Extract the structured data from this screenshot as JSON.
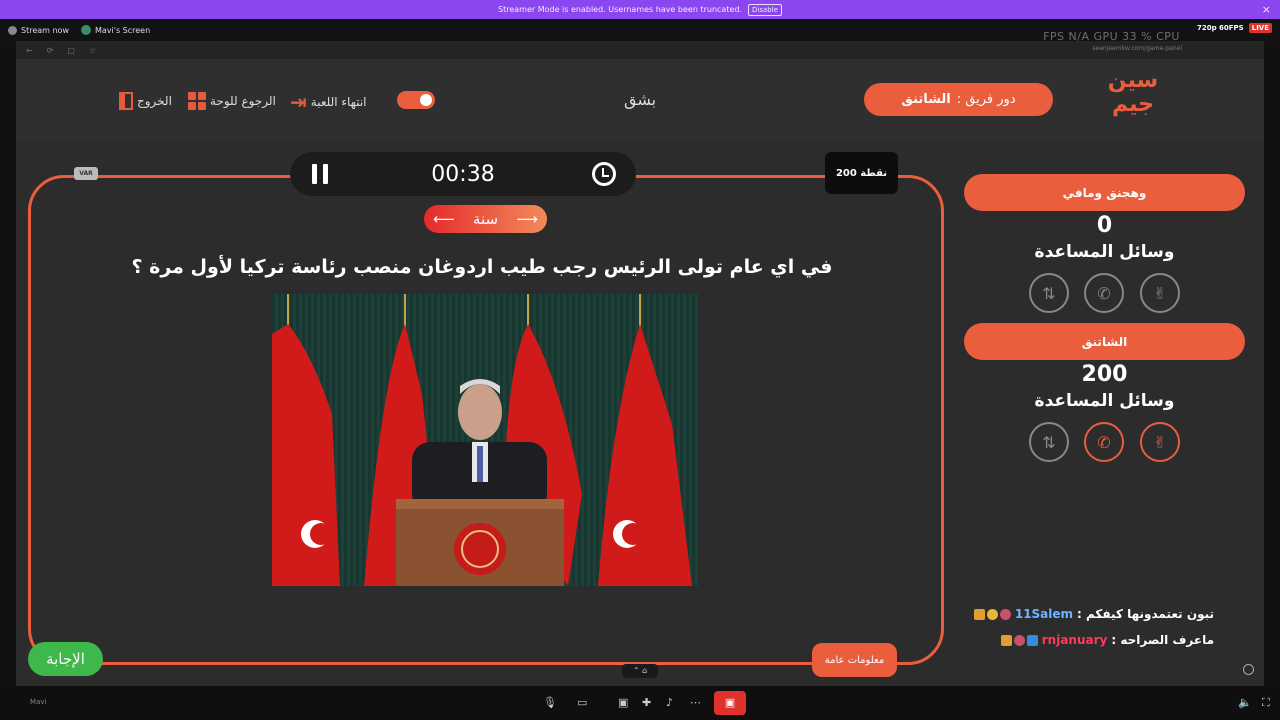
{
  "banner": {
    "message": "Streamer Mode is enabled. Usernames have been truncated.",
    "disable_label": "Disable",
    "close": "×"
  },
  "stream": {
    "label": "Stream now",
    "screen_label": "Mavi's Screen",
    "overlay_stats": "FPS  N/A   GPU 33 %   CPU",
    "quality": "720p 60FPS",
    "live": "LIVE"
  },
  "browser": {
    "url": "seenjeemkw.com/game-panel"
  },
  "header": {
    "exit_label": "الخروج",
    "board_label": "الرجوع للوحة",
    "end_game_label": "انتهاء اللعبة",
    "center_team": "بشق",
    "turn_prefix": "دور فريق :",
    "turn_team": "الشاتنق",
    "logo_text": "سين جيم"
  },
  "question": {
    "var_label": "VAR",
    "timer": "00:38",
    "points": "200 نقطة",
    "hint": "سنة",
    "text": "في اي عام تولى الرئيس رجب طيب اردوغان منصب رئاسة تركيا لأول مرة ؟",
    "answer_label": "الإجابة",
    "info_label": "معلومات عامة"
  },
  "teams": [
    {
      "name": "وهجنق ومافي",
      "score": "0",
      "aids_label": "وسائل المساعدة",
      "aids_active": false
    },
    {
      "name": "الشاتنق",
      "score": "200",
      "aids_label": "وسائل المساعدة",
      "aids_active": true
    }
  ],
  "chat": [
    {
      "user": "11Salem",
      "message": "تبون تعتمدونها كيفكم :",
      "user_color": "#6fb4ff"
    },
    {
      "user": "rnjanuary",
      "message": "ماعرف الصراحه :",
      "user_color": "#ff3b5c"
    }
  ],
  "toolbar": {
    "user": "Mavi"
  },
  "colors": {
    "accent": "#ea5e3d",
    "answer": "#3fb84b",
    "banner": "#8c46f0"
  }
}
